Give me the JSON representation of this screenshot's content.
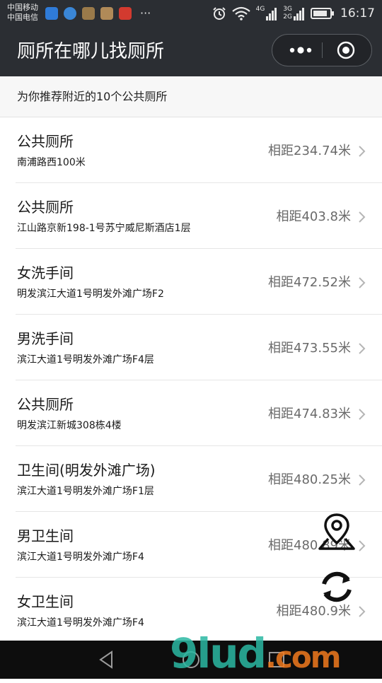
{
  "status_bar": {
    "carrier_1": "中国移动",
    "carrier_2": "中国电信",
    "network_1": "4G",
    "network_2": "3G",
    "network_3": "2G",
    "time": "16:17",
    "app_icon_colors": [
      "#2f7bd8",
      "#3a86d6",
      "#9a7a4a",
      "#b08a58",
      "#d33a2f"
    ]
  },
  "header": {
    "title": "厕所在哪儿找厕所"
  },
  "subheader": {
    "text": "为你推荐附近的10个公共厕所"
  },
  "toilets": [
    {
      "name": "公共厕所",
      "address": "南浦路西100米",
      "distance": "相距234.74米"
    },
    {
      "name": "公共厕所",
      "address": "江山路京新198-1号苏宁威尼斯酒店1层",
      "distance": "相距403.8米"
    },
    {
      "name": "女洗手间",
      "address": "明发滨江大道1号明发外滩广场F2",
      "distance": "相距472.52米"
    },
    {
      "name": "男洗手间",
      "address": "滨江大道1号明发外滩广场F4层",
      "distance": "相距473.55米"
    },
    {
      "name": "公共厕所",
      "address": "明发滨江新城308栋4楼",
      "distance": "相距474.83米"
    },
    {
      "name": "卫生间(明发外滩广场)",
      "address": "滨江大道1号明发外滩广场F1层",
      "distance": "相距480.25米"
    },
    {
      "name": "男卫生间",
      "address": "滨江大道1号明发外滩广场F4",
      "distance": "相距480.89米"
    },
    {
      "name": "女卫生间",
      "address": "滨江大道1号明发外滩广场F4",
      "distance": "相距480.9米"
    }
  ],
  "floating_buttons": {
    "map_icon": "map-pin-icon",
    "refresh_icon": "refresh-icon"
  },
  "watermark": {
    "text_main": "9lud",
    "text_dot": ".com"
  },
  "nav_bar": {
    "back_icon": "back-triangle-icon",
    "home_icon": "home-circle-icon",
    "recent_icon": "recent-square-icon"
  },
  "colors": {
    "title_bar": "#2b2e33",
    "subheader_bg": "#f7f7f7",
    "distance_text": "#6a6a6a",
    "watermark_teal": "#2bb8a3",
    "watermark_orange": "#f07a1e"
  }
}
